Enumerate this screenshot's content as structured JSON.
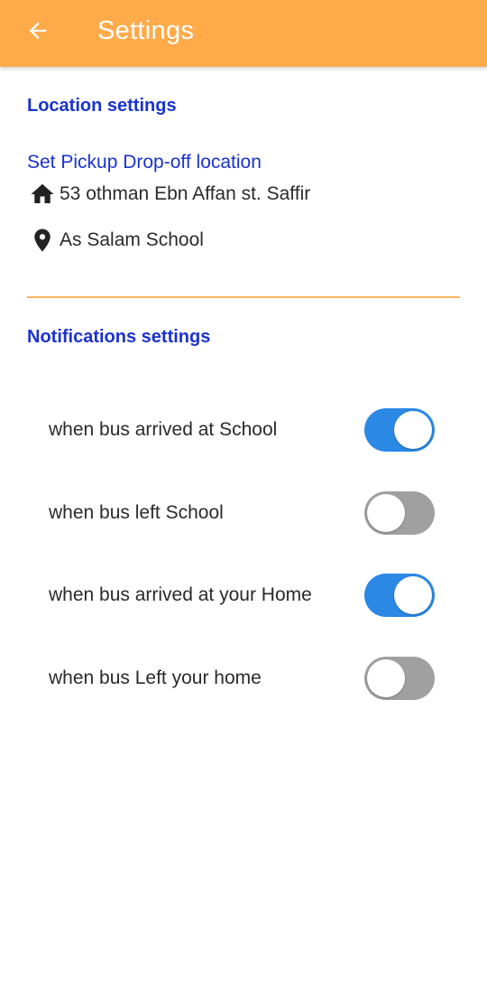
{
  "app_bar": {
    "title": "Settings",
    "back_icon": "arrow-left-icon",
    "color": "#FFAB4A"
  },
  "location_section": {
    "title": "Location settings",
    "link_label": "Set Pickup Drop-off location",
    "home": {
      "icon": "home-icon",
      "address": "53 othman Ebn Affan st. Saffir"
    },
    "school": {
      "icon": "map-pin-icon",
      "name": "As Salam School"
    }
  },
  "notifications_section": {
    "title": "Notifications settings",
    "items": [
      {
        "label": "when bus arrived at School",
        "enabled": true
      },
      {
        "label": "when bus left School",
        "enabled": false
      },
      {
        "label": "when bus arrived at your Home",
        "enabled": true
      },
      {
        "label": "when bus Left your home",
        "enabled": false
      }
    ]
  },
  "colors": {
    "accent_blue": "#1A33CC",
    "toggle_on": "#2B88E4",
    "toggle_off": "#A0A0A0",
    "divider": "#F4B45F"
  }
}
